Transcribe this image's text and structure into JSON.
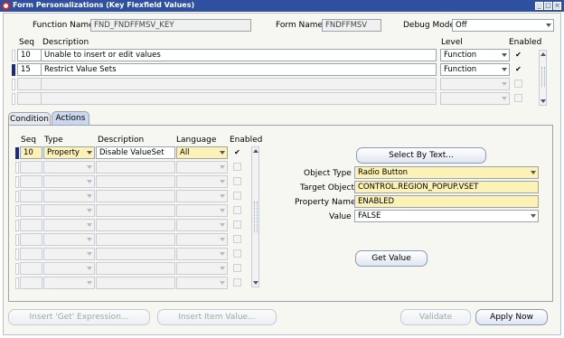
{
  "window": {
    "title": "Form Personalizations (Key Flexfield Values)",
    "min_icon": "minimize-icon",
    "max_icon": "maximize-icon",
    "close_icon": "close-icon"
  },
  "header": {
    "function_name_label": "Function Name",
    "function_name_value": "FND_FNDFFMSV_KEY",
    "form_name_label": "Form Name",
    "form_name_value": "FNDFFMSV",
    "debug_mode_label": "Debug Mode",
    "debug_mode_value": "Off"
  },
  "rules": {
    "col_seq": "Seq",
    "col_description": "Description",
    "col_level": "Level",
    "col_enabled": "Enabled",
    "rows": [
      {
        "seq": "10",
        "description": "Unable to insert or edit values",
        "level": "Function",
        "enabled": "✔"
      },
      {
        "seq": "15",
        "description": "Restrict Value Sets",
        "level": "Function",
        "enabled": "✔"
      },
      {
        "seq": "",
        "description": "",
        "level": "",
        "enabled": ""
      },
      {
        "seq": "",
        "description": "",
        "level": "",
        "enabled": ""
      }
    ]
  },
  "tabs": {
    "condition": "Condition",
    "actions": "Actions"
  },
  "actions": {
    "col_seq": "Seq",
    "col_type": "Type",
    "col_description": "Description",
    "col_language": "Language",
    "col_enabled": "Enabled",
    "rows": [
      {
        "seq": "10",
        "type": "Property",
        "description": "Disable ValueSet",
        "language": "All",
        "enabled": "✔"
      },
      {
        "seq": "",
        "type": "",
        "description": "",
        "language": "",
        "enabled": ""
      },
      {
        "seq": "",
        "type": "",
        "description": "",
        "language": "",
        "enabled": ""
      },
      {
        "seq": "",
        "type": "",
        "description": "",
        "language": "",
        "enabled": ""
      },
      {
        "seq": "",
        "type": "",
        "description": "",
        "language": "",
        "enabled": ""
      },
      {
        "seq": "",
        "type": "",
        "description": "",
        "language": "",
        "enabled": ""
      },
      {
        "seq": "",
        "type": "",
        "description": "",
        "language": "",
        "enabled": ""
      },
      {
        "seq": "",
        "type": "",
        "description": "",
        "language": "",
        "enabled": ""
      },
      {
        "seq": "",
        "type": "",
        "description": "",
        "language": "",
        "enabled": ""
      },
      {
        "seq": "",
        "type": "",
        "description": "",
        "language": "",
        "enabled": ""
      }
    ]
  },
  "property": {
    "select_by_text": "Select By Text...",
    "object_type_label": "Object Type",
    "object_type_value": "Radio Button",
    "target_object_label": "Target Object",
    "target_object_value": "CONTROL.REGION_POPUP.VSET",
    "property_name_label": "Property Name",
    "property_name_value": "ENABLED",
    "value_label": "Value",
    "value_value": "FALSE",
    "get_value": "Get Value"
  },
  "footer": {
    "insert_get_expression": "Insert 'Get' Expression...",
    "insert_item_value": "Insert Item Value...",
    "validate": "Validate",
    "apply_now": "Apply Now"
  },
  "colors": {
    "titlebar": "#2f4fa0",
    "required_field": "#fcf2b5",
    "frame": "#f7f7f1"
  }
}
